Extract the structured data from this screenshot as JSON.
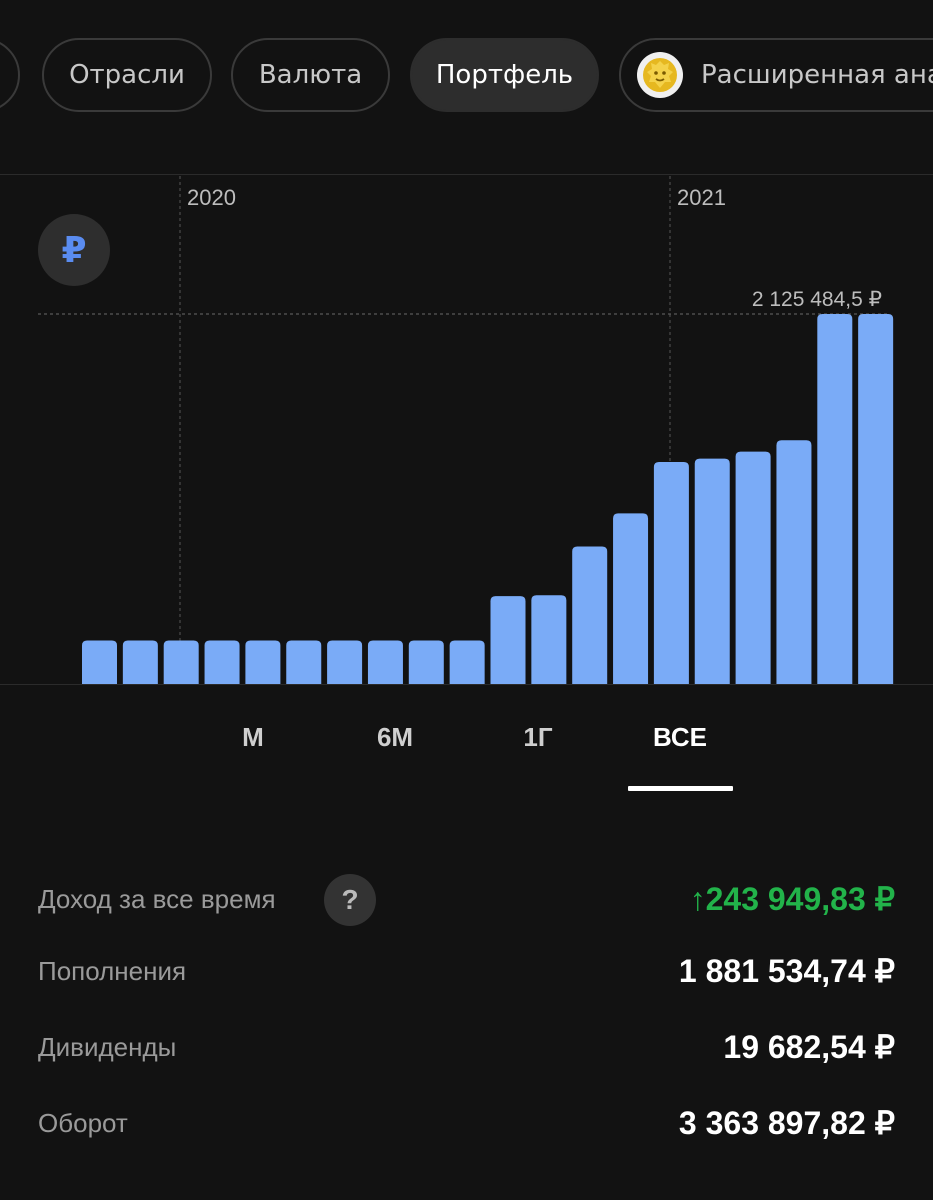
{
  "filters": {
    "chips": [
      {
        "label": "",
        "active": false
      },
      {
        "label": "Отрасли",
        "active": false
      },
      {
        "label": "Валюта",
        "active": false
      },
      {
        "label": "Портфель",
        "active": true
      },
      {
        "label": "Расширенная ана",
        "active": false,
        "icon": "lion-icon"
      }
    ]
  },
  "currency_button": {
    "label": "₽",
    "icon": "ruble-icon"
  },
  "chart_data": {
    "type": "bar",
    "x_labels": [
      "2020",
      "2021"
    ],
    "max_label": "2 125 484,5 ₽",
    "values": [
      250000,
      250000,
      250000,
      250000,
      250000,
      250000,
      250000,
      250000,
      250000,
      250000,
      505000,
      510000,
      790000,
      980000,
      1275000,
      1295000,
      1335000,
      1400000,
      2125484.5,
      2125484.5
    ],
    "ylim": [
      0,
      2125484.5
    ],
    "bar_color": "#7aabf7",
    "grid": true
  },
  "periods": {
    "items": [
      "М",
      "6М",
      "1Г",
      "ВСЕ"
    ],
    "active": "ВСЕ"
  },
  "stats": {
    "income_label": "Доход за все время",
    "income_help": "?",
    "income_value": "↑243 949,83 ₽",
    "deposits_label": "Пополнения",
    "deposits_value": "1 881 534,74 ₽",
    "dividends_label": "Дивиденды",
    "dividends_value": "19 682,54 ₽",
    "turnover_label": "Оборот",
    "turnover_value": "3 363 897,82 ₽",
    "positive_color": "#22b34a"
  }
}
